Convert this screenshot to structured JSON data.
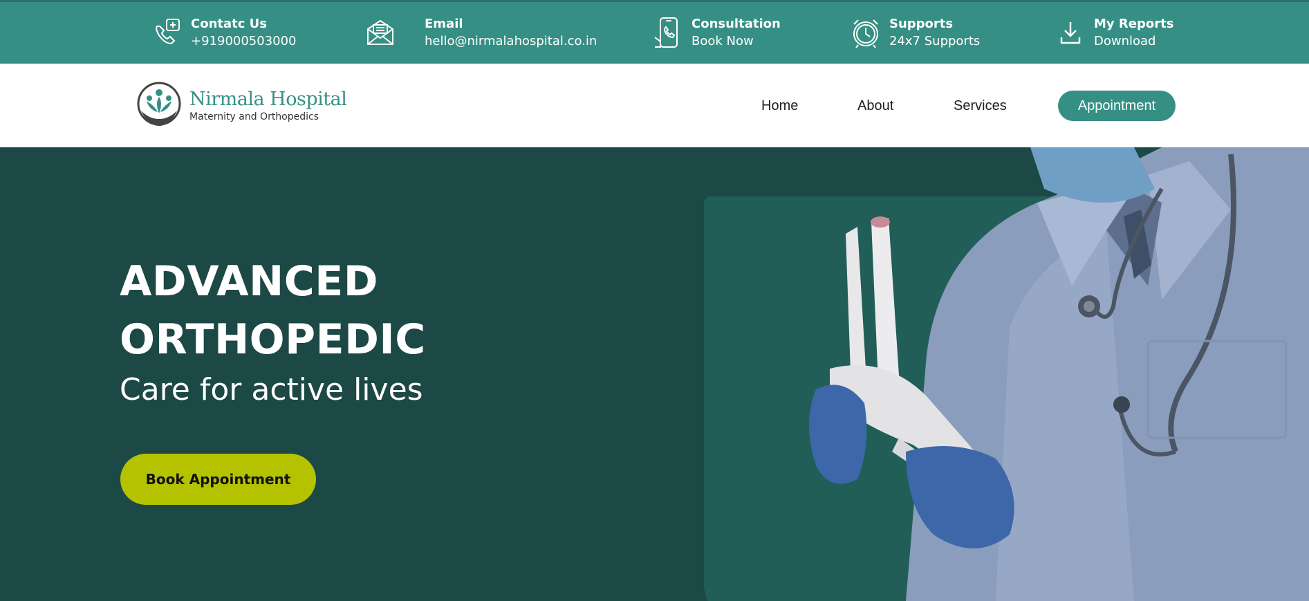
{
  "topbar": {
    "items": [
      {
        "icon": "phone-medical-icon",
        "title": "Contatc Us",
        "value": "+919000503000"
      },
      {
        "icon": "envelope-icon",
        "title": "Email",
        "value": "hello@nirmalahospital.co.in"
      },
      {
        "icon": "mobile-phone-icon",
        "title": "Consultation",
        "value": "Book Now"
      },
      {
        "icon": "alarm-clock-icon",
        "title": "Supports",
        "value": "24x7 Supports"
      },
      {
        "icon": "download-icon",
        "title": "My Reports",
        "value": "Download"
      }
    ]
  },
  "brand": {
    "name": "Nirmala Hospital",
    "tagline": "Maternity and Orthopedics"
  },
  "nav": {
    "links": [
      "Home",
      "About",
      "Services"
    ],
    "cta": "Appointment"
  },
  "hero": {
    "title_line1": "ADVANCED",
    "title_line2": "ORTHOPEDIC",
    "subtitle": "Care for active lives",
    "button": "Book Appointment"
  },
  "colors": {
    "primary": "#368f84",
    "hero_bg": "#1c4945",
    "hero_panel": "#215e58",
    "cta_button": "#b5c200"
  }
}
